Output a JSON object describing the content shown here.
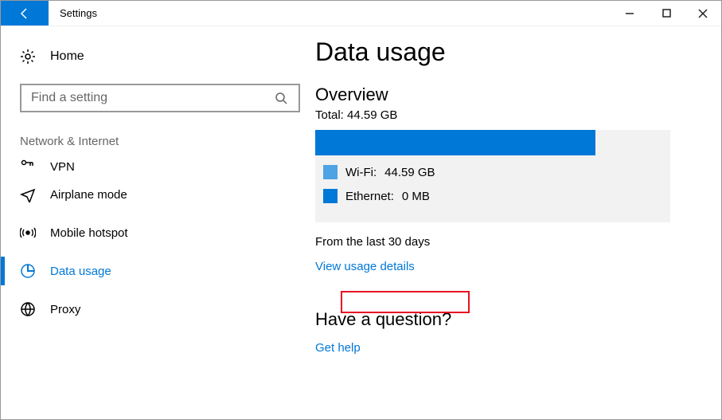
{
  "window": {
    "title": "Settings"
  },
  "sidebar": {
    "home": "Home",
    "search": {
      "placeholder": "Find a setting"
    },
    "section": "Network & Internet",
    "items": [
      {
        "label": "VPN"
      },
      {
        "label": "Airplane mode"
      },
      {
        "label": "Mobile hotspot"
      },
      {
        "label": "Data usage"
      },
      {
        "label": "Proxy"
      }
    ]
  },
  "main": {
    "title": "Data usage",
    "overview": "Overview",
    "total": "Total: 44.59 GB",
    "wifi": {
      "label": "Wi-Fi:",
      "value": "44.59 GB"
    },
    "ethernet": {
      "label": "Ethernet:",
      "value": "0 MB"
    },
    "since": "From the last 30 days",
    "details_link": "View usage details",
    "question": "Have a question?",
    "help_link": "Get help"
  },
  "chart_data": {
    "type": "bar",
    "title": "Data usage overview",
    "categories": [
      "Wi-Fi",
      "Ethernet"
    ],
    "values": [
      44.59,
      0
    ],
    "unit": "GB",
    "total": 44.59
  }
}
